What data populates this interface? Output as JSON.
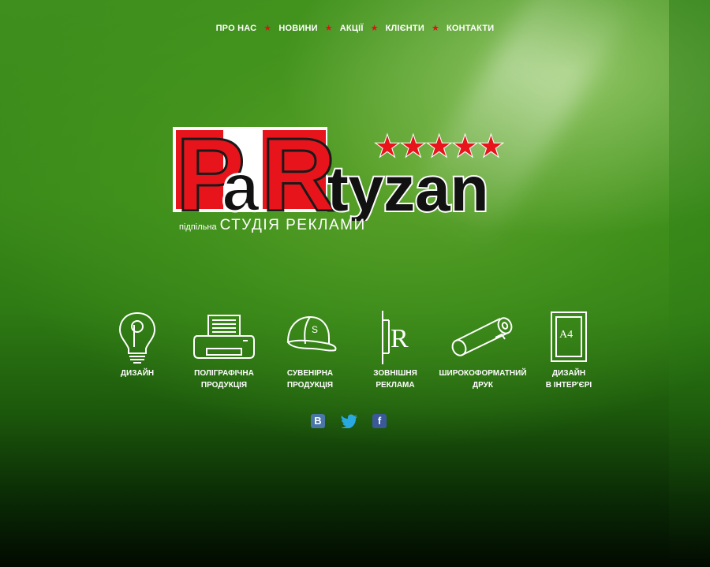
{
  "nav": {
    "items": [
      {
        "label": "ПРО НАС"
      },
      {
        "label": "НОВИНИ"
      },
      {
        "label": "АКЦІЇ"
      },
      {
        "label": "КЛІЄНТИ"
      },
      {
        "label": "КОНТАКТИ"
      }
    ],
    "separator": "★"
  },
  "logo": {
    "p_letter": "P",
    "a_letter": "a",
    "r_letter": "R",
    "rest": "tyzan",
    "stars": "★★★★★",
    "tagline_small": "підпільна",
    "tagline_big": "СТУДІЯ РЕКЛАМИ"
  },
  "services": [
    {
      "label": "ДИЗАЙН",
      "icon": "lightbulb-icon"
    },
    {
      "label": "ПОЛІГРАФІЧНА\nПРОДУКЦІЯ",
      "icon": "printer-icon"
    },
    {
      "label": "СУВЕНІРНА\nПРОДУКЦІЯ",
      "icon": "cap-icon"
    },
    {
      "label": "ЗОВНІШНЯ\nРЕКЛАМА",
      "icon": "signboard-icon"
    },
    {
      "label": "ШИРОКОФОРМАТНИЙ\nДРУК",
      "icon": "roll-icon"
    },
    {
      "label": "ДИЗАЙН\nВ ІНТЕР'ЄРІ",
      "icon": "a4-frame-icon"
    }
  ],
  "social": {
    "vk": "B",
    "twitter": "t",
    "facebook": "f"
  },
  "colors": {
    "accent_red": "#e8141c",
    "nav_star": "#d8141c",
    "vk": "#4a76a8",
    "twitter": "#2aa9e0",
    "facebook": "#3b5998"
  }
}
